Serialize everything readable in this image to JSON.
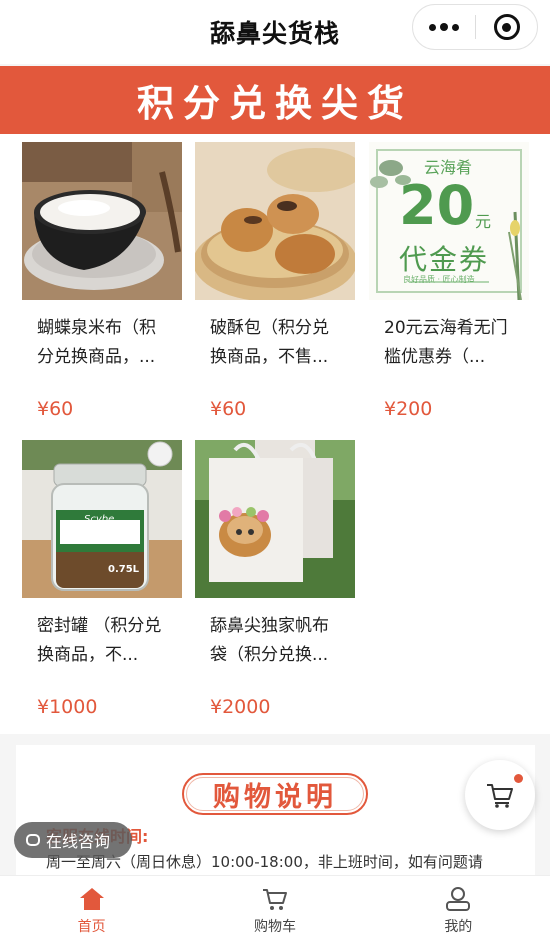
{
  "nav": {
    "title": "舔鼻尖货栈"
  },
  "banner": {
    "text": "积分兑换尖货"
  },
  "products": [
    {
      "name": "蝴蝶泉米布（积分兑换商品，...",
      "price": "¥60",
      "image": "rice-pudding-bowl"
    },
    {
      "name": "破酥包（积分兑换商品，不售...",
      "price": "¥60",
      "image": "pastry-buns"
    },
    {
      "name": "20元云海肴无门槛优惠券（...",
      "price": "¥200",
      "image": "voucher-card"
    },
    {
      "name": "密封罐 （积分兑换商品，不...",
      "price": "¥1000",
      "image": "glass-jar"
    },
    {
      "name": "舔鼻尖独家帆布袋（积分兑换...",
      "price": "¥2000",
      "image": "canvas-tote-bag"
    }
  ],
  "voucher": {
    "brand": "云海肴",
    "amount": "20",
    "unit": "元",
    "label": "代金券",
    "footer": "良好品质 · 匠心制造"
  },
  "jar": {
    "brand": "Scybe",
    "volume": "0.75L"
  },
  "info": {
    "title": "购物说明",
    "subtitle": "客服在线时间:",
    "text": "周一至周六（周日休息）10:00-18:00，非上班时间，如有问题请"
  },
  "consult": {
    "label": "在线咨询"
  },
  "tabs": [
    {
      "label": "首页",
      "icon": "home-icon",
      "active": true
    },
    {
      "label": "购物车",
      "icon": "cart-icon",
      "active": false
    },
    {
      "label": "我的",
      "icon": "user-icon",
      "active": false
    }
  ],
  "colors": {
    "accent": "#e2583c",
    "voucher_green": "#5aa35a"
  }
}
